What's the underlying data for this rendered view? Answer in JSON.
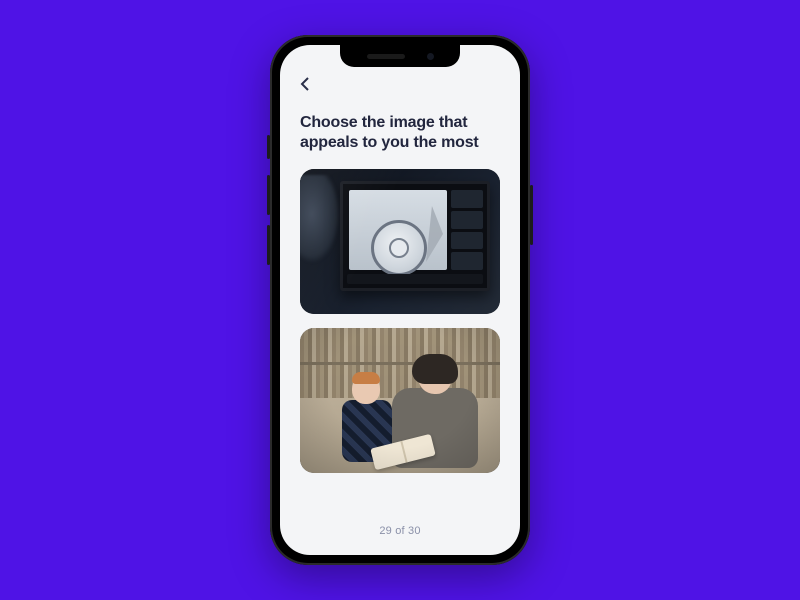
{
  "question": {
    "title": "Choose the image that appeals to you the most"
  },
  "options": [
    {
      "name": "designer-cad-workstation"
    },
    {
      "name": "librarian-reading-with-child"
    }
  ],
  "progress": {
    "text": "29 of 30",
    "current": 29,
    "total": 30
  },
  "icons": {
    "back": "chevron-left"
  },
  "colors": {
    "page_bg": "#4f13e6",
    "screen_bg": "#f4f5f7",
    "heading": "#22263e",
    "muted": "#8a90a8"
  }
}
